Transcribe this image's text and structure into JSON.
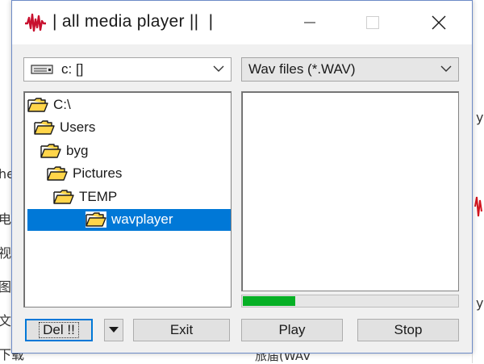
{
  "window": {
    "title": "| all media player ||  |"
  },
  "drive": {
    "value": "c: []"
  },
  "filter": {
    "value": "Wav files (*.WAV)"
  },
  "directories": [
    {
      "label": "C:\\",
      "level": 0,
      "open": true,
      "selected": false
    },
    {
      "label": "Users",
      "level": 1,
      "open": true,
      "selected": false
    },
    {
      "label": "byg",
      "level": 2,
      "open": true,
      "selected": false
    },
    {
      "label": "Pictures",
      "level": 3,
      "open": true,
      "selected": false
    },
    {
      "label": "TEMP",
      "level": 4,
      "open": true,
      "selected": false
    },
    {
      "label": "wavplayer",
      "level": 5,
      "open": true,
      "selected": true
    }
  ],
  "files": [],
  "progress": {
    "fraction": 0.25
  },
  "buttons": {
    "del": "Del !!",
    "exit": "Exit",
    "play": "Play",
    "stop": "Stop"
  },
  "background": {
    "left_fragments": [
      "he",
      "电",
      "视",
      "图",
      "文",
      "下载"
    ],
    "right_fragments": [
      "y",
      "y"
    ],
    "bottom_fragment": "旅届(WAV"
  },
  "colors": {
    "selection": "#0078d7",
    "progress": "#06b025",
    "window_border": "#6d8bc7",
    "app_icon": "#c8102e"
  }
}
